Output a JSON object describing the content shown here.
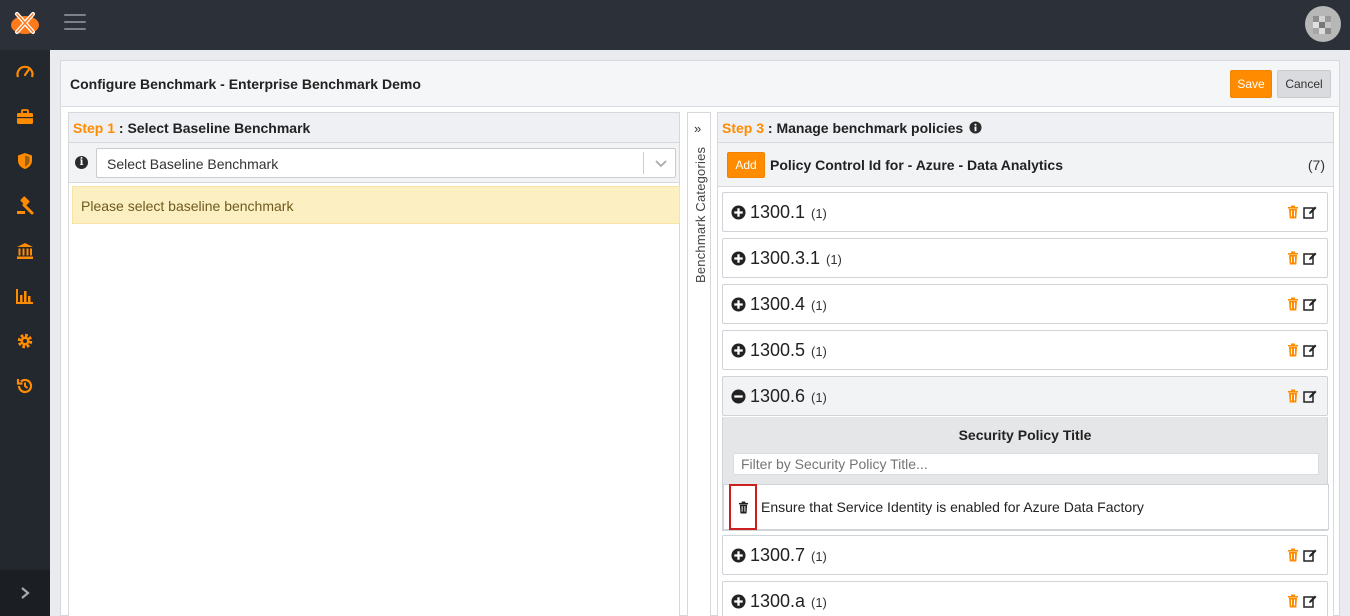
{
  "header": {
    "avatar_alt": "user-avatar"
  },
  "sidebar": {
    "items": [
      {
        "icon": "speedometer-icon"
      },
      {
        "icon": "briefcase-icon"
      },
      {
        "icon": "shield-icon"
      },
      {
        "icon": "gavel-icon"
      },
      {
        "icon": "bank-icon"
      },
      {
        "icon": "bar-chart-icon"
      },
      {
        "icon": "gear-icon"
      },
      {
        "icon": "history-icon"
      }
    ],
    "expand_icon": "chevron-right-icon"
  },
  "page": {
    "title": "Configure Benchmark - Enterprise Benchmark Demo",
    "save_label": "Save",
    "cancel_label": "Cancel"
  },
  "step1": {
    "step_label": "Step 1",
    "title": " : Select Baseline Benchmark",
    "select_value": "Select Baseline Benchmark",
    "alert": "Please select baseline benchmark"
  },
  "collapser": {
    "chevron": "»",
    "label": "Benchmark Categories"
  },
  "step3": {
    "step_label": "Step 3",
    "title": " : Manage benchmark policies",
    "add_label": "Add",
    "policy_header": "Policy Control Id for - Azure - Data Analytics",
    "count": "(7)",
    "policies": [
      {
        "id": "1300.1",
        "count": "(1)"
      },
      {
        "id": "1300.3.1",
        "count": "(1)"
      },
      {
        "id": "1300.4",
        "count": "(1)"
      },
      {
        "id": "1300.5",
        "count": "(1)"
      },
      {
        "id": "1300.6",
        "count": "(1)"
      },
      {
        "id": "1300.7",
        "count": "(1)"
      },
      {
        "id": "1300.a",
        "count": "(1)"
      }
    ],
    "expanded": {
      "column_title": "Security Policy Title",
      "filter_placeholder": "Filter by Security Policy Title...",
      "row_text": "Ensure that Service Identity is enabled for Azure Data Factory"
    }
  },
  "colors": {
    "accent": "#ff8c00",
    "topbar": "#2c3039",
    "sidebar": "#23272e",
    "highlight": "#cc1f1f"
  }
}
